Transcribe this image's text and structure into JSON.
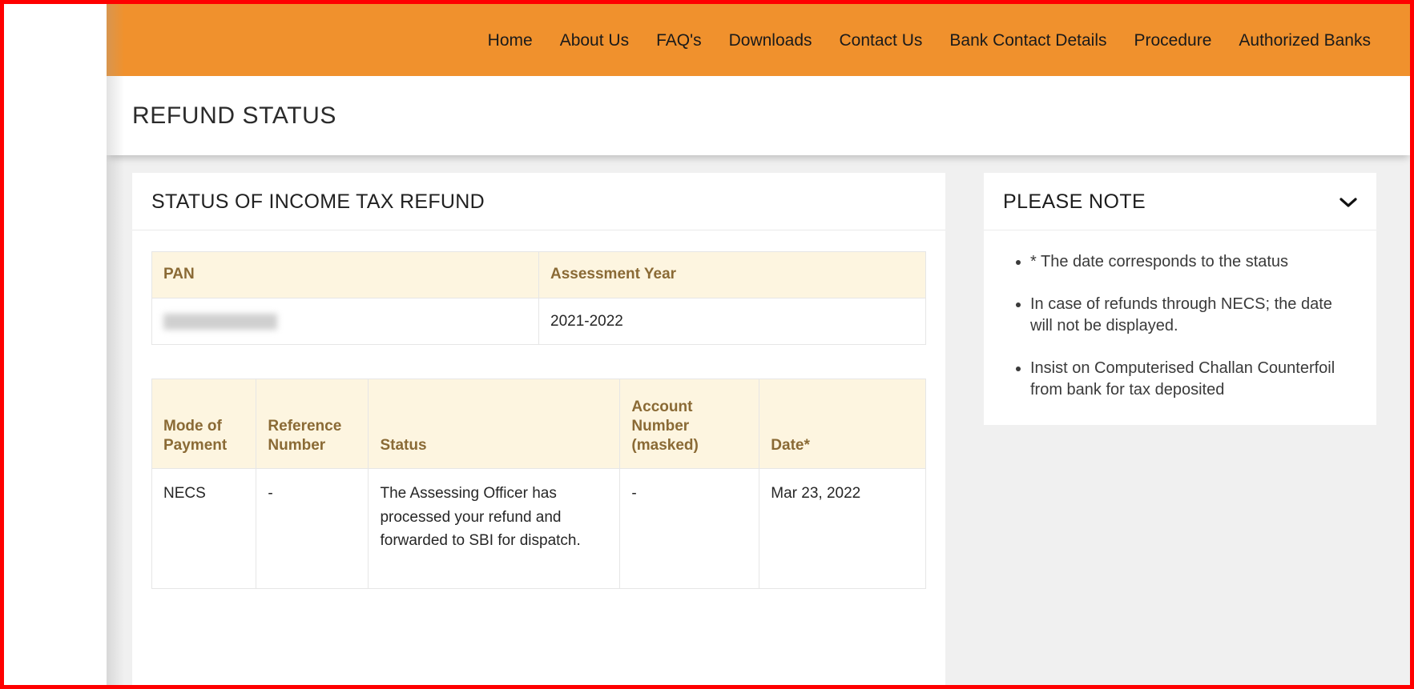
{
  "nav": {
    "items": [
      {
        "label": "Home"
      },
      {
        "label": "About Us"
      },
      {
        "label": "FAQ's"
      },
      {
        "label": "Downloads"
      },
      {
        "label": "Contact Us"
      },
      {
        "label": "Bank Contact Details"
      },
      {
        "label": "Procedure"
      },
      {
        "label": "Authorized Banks"
      }
    ]
  },
  "page": {
    "title": "REFUND STATUS"
  },
  "main_card": {
    "title": "STATUS OF INCOME TAX REFUND",
    "pan_table": {
      "headers": [
        "PAN",
        "Assessment Year"
      ],
      "rows": [
        {
          "pan": "",
          "assessment_year": "2021-2022"
        }
      ]
    },
    "status_table": {
      "headers": [
        "Mode of Payment",
        "Reference Number",
        "Status",
        "Account Number (masked)",
        "Date*"
      ],
      "rows": [
        {
          "mode_of_payment": "NECS",
          "reference_number": "-",
          "status": "The Assessing Officer has processed your refund and forwarded to SBI for dispatch.",
          "account_number_masked": "-",
          "date": "Mar 23, 2022"
        }
      ]
    }
  },
  "note_card": {
    "title": "PLEASE NOTE",
    "toggle_icon": "chevron-down-icon",
    "items": [
      "* The date corresponds to the status",
      "In case of refunds through NECS; the date will not be displayed.",
      "Insist on Computerised Challan Counterfoil from bank for tax deposited"
    ]
  },
  "colors": {
    "nav_background": "#f0912d",
    "table_header_background": "#fdf5e0",
    "table_header_text": "#8a6a35",
    "annotation_border": "#ff0000",
    "page_background": "#f0f0f0"
  }
}
